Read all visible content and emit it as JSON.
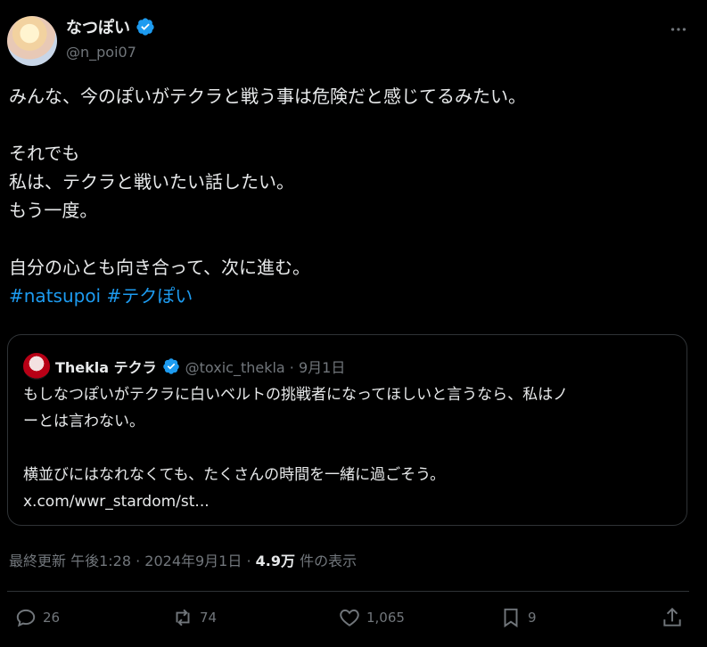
{
  "author": {
    "display_name": "なつぽい",
    "handle": "@n_poi07"
  },
  "tweet": {
    "lines_block1": "みんな、今のぽいがテクラと戦う事は危険だと感じてるみたい。",
    "lines_block2": [
      "それでも",
      "私は、テクラと戦いたい話したい。",
      "もう一度。"
    ],
    "lines_block3": "自分の心とも向き合って、次に進む。",
    "hashtags": "#natsupoi #テクぽい"
  },
  "quote": {
    "display_name": "Thekla テクラ",
    "handle_time": "@toxic_thekla · 9月1日",
    "line1": "もしなつぽいがテクラに白いベルトの挑戦者になってほしいと言うなら、私はノ",
    "line2": "ーとは言わない。",
    "line3": "横並びにはなれなくても、たくさんの時間を一緒に過ごそう。",
    "link": "x.com/wwr_stardom/st..."
  },
  "meta": {
    "prefix": "最終更新 午後1:28 · 2024年9月1日 · ",
    "views": "4.9万",
    "suffix": " 件の表示"
  },
  "actions": {
    "replies": "26",
    "reposts": "74",
    "likes": "1,065",
    "bookmarks": "9"
  },
  "colors": {
    "background": "#000000",
    "text": "#e7e9ea",
    "secondary": "#71767b",
    "accent": "#1d9bf0",
    "border": "#2f3336"
  }
}
